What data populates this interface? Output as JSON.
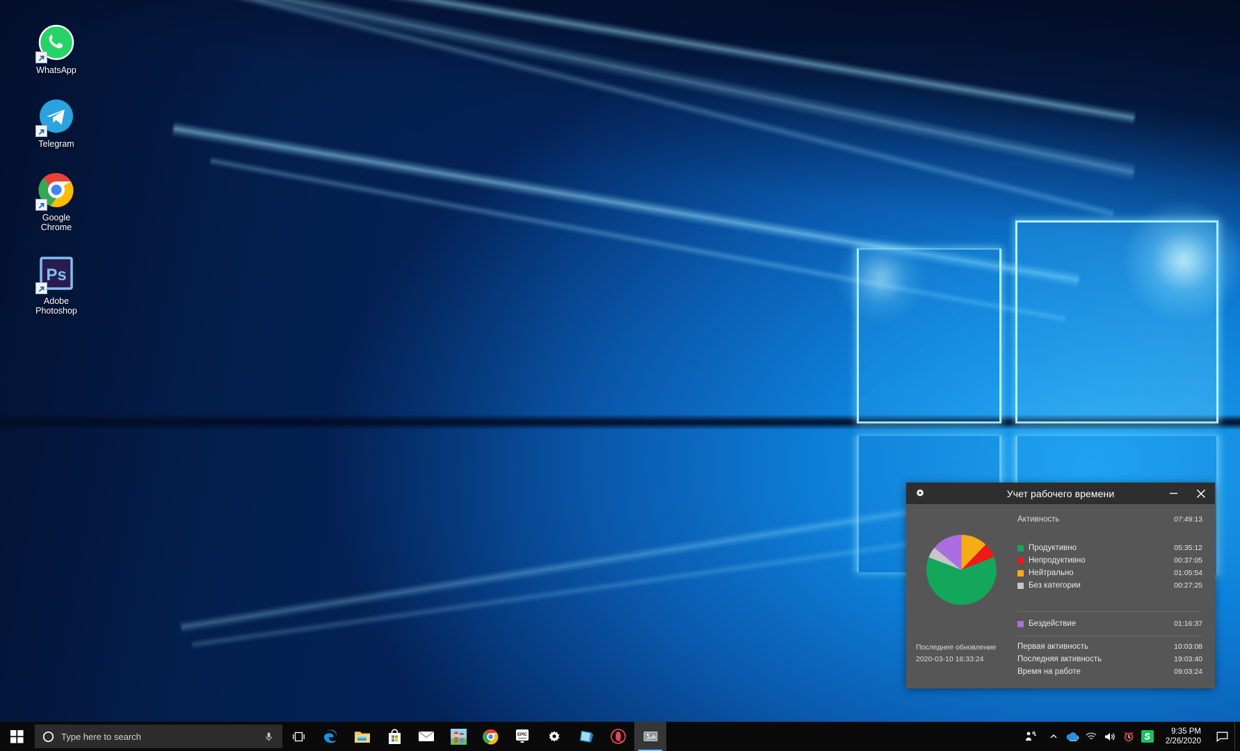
{
  "desktop": {
    "icons": [
      {
        "name": "whatsapp",
        "label": "WhatsApp"
      },
      {
        "name": "telegram",
        "label": "Telegram"
      },
      {
        "name": "google-chrome",
        "label": "Google\nChrome"
      },
      {
        "name": "adobe-photoshop",
        "label": "Adobe\nPhotoshop"
      }
    ]
  },
  "tracker": {
    "title": "Учет рабочего времени",
    "gear_icon": "gear-icon",
    "minimize_label": "—",
    "close_label": "✕",
    "activity": {
      "label": "Активность",
      "value": "07:49:13"
    },
    "legend": [
      {
        "label": "Продуктивно",
        "value": "05:35:12",
        "color": "#13a75b"
      },
      {
        "label": "Непродуктивно",
        "value": "00:37:05",
        "color": "#f01818"
      },
      {
        "label": "Нейтрально",
        "value": "01:05:54",
        "color": "#f5ad13"
      },
      {
        "label": "Без категории",
        "value": "00:27:25",
        "color": "#c6c6c6"
      }
    ],
    "idle": {
      "label": "Бездействие",
      "value": "01:16:37",
      "color": "#ab6ee0"
    },
    "stats": [
      {
        "label": "Первая активность",
        "value": "10:03:08"
      },
      {
        "label": "Последняя активность",
        "value": "19:03:40"
      },
      {
        "label": "Время на работе",
        "value": "09:03:24"
      }
    ],
    "last_update": {
      "label": "Последнее обновление",
      "value": "2020-03-10 16:33:24"
    }
  },
  "chart_data": {
    "type": "pie",
    "title": "Активность",
    "legend_position": "right",
    "categories": [
      "Нейтрально",
      "Непродуктивно",
      "Продуктивно",
      "Без категории",
      "Бездействие"
    ],
    "values": [
      3954,
      2225,
      20112,
      1645,
      4597
    ],
    "value_unit": "seconds",
    "labels": [
      "01:05:54",
      "00:37:05",
      "05:35:12",
      "00:27:25",
      "01:16:37"
    ],
    "colors": [
      "#f5ad13",
      "#f01818",
      "#13a75b",
      "#c6c6c6",
      "#ab6ee0"
    ],
    "start_angle_deg": 0,
    "direction": "clockwise",
    "total": "07:49:13"
  },
  "taskbar": {
    "start_label": "Start",
    "search_placeholder": "Type here to search",
    "items": [
      {
        "name": "task-view",
        "label": "Task View"
      },
      {
        "name": "microsoft-edge",
        "label": "Microsoft Edge"
      },
      {
        "name": "file-explorer",
        "label": "File Explorer"
      },
      {
        "name": "microsoft-store",
        "label": "Microsoft Store"
      },
      {
        "name": "mail",
        "label": "Mail"
      },
      {
        "name": "game-app",
        "label": "Game"
      },
      {
        "name": "google-chrome",
        "label": "Google Chrome"
      },
      {
        "name": "epic-games",
        "label": "Epic Games Launcher"
      },
      {
        "name": "settings",
        "label": "Settings"
      },
      {
        "name": "sticky-notes",
        "label": "Sticky Notes"
      },
      {
        "name": "opera",
        "label": "Opera"
      },
      {
        "name": "time-tracker",
        "label": "Учет рабочего времени"
      }
    ],
    "tray": [
      {
        "name": "people",
        "label": "People"
      },
      {
        "name": "show-hidden",
        "label": "Show hidden icons"
      },
      {
        "name": "onedrive",
        "label": "OneDrive"
      },
      {
        "name": "network",
        "label": "Network"
      },
      {
        "name": "volume",
        "label": "Volume"
      },
      {
        "name": "alarm",
        "label": "Alarm"
      },
      {
        "name": "green-app",
        "label": "S"
      }
    ],
    "clock": {
      "time": "9:35 PM",
      "date": "2/26/2020"
    }
  }
}
